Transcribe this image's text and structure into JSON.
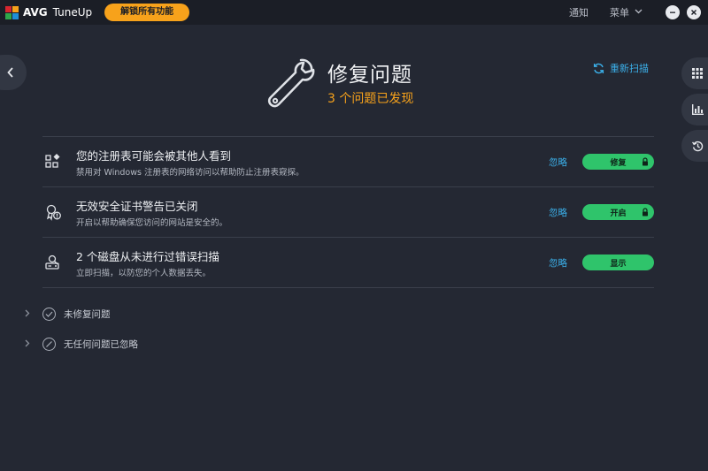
{
  "app": {
    "brand": "AVG",
    "product": "TuneUp",
    "unlock_label": "解锁所有功能",
    "brand_colors": [
      "#d7262f",
      "#f7a21b",
      "#2fa64a",
      "#1f8fd6"
    ]
  },
  "titlebar": {
    "notifications_label": "通知",
    "menu_label": "菜单",
    "menu_icon": "chevron-down-icon",
    "minimize_icon": "minimize-icon",
    "close_icon": "close-icon"
  },
  "header": {
    "icon": "wrench-icon",
    "title": "修复问题",
    "subtitle": "3 个问题已发现",
    "rescan_label": "重新扫描",
    "rescan_icon": "refresh-icon"
  },
  "sidebar": {
    "back_icon": "chevron-left-icon",
    "items": [
      {
        "icon": "grid-icon"
      },
      {
        "icon": "bar-chart-icon"
      },
      {
        "icon": "history-icon"
      }
    ]
  },
  "issues": [
    {
      "icon": "registry-icon",
      "title": "您的注册表可能会被其他人看到",
      "description": "禁用对 Windows 注册表的网络访问以帮助防止注册表窥探。",
      "ignore_label": "忽略",
      "action_label": "修复",
      "locked": true
    },
    {
      "icon": "certificate-warning-icon",
      "title": "无效安全证书警告已关闭",
      "description": "开启以帮助确保您访问的网站是安全的。",
      "ignore_label": "忽略",
      "action_label": "开启",
      "locked": true
    },
    {
      "icon": "disk-scan-icon",
      "title": "2 个磁盘从未进行过错误扫描",
      "description": "立即扫描，以防您的个人数据丢失。",
      "ignore_label": "忽略",
      "action_label": "显示",
      "locked": false
    }
  ],
  "sections": [
    {
      "label": "未修复问题",
      "icon": "check-circle-icon"
    },
    {
      "label": "无任何问题已忽略",
      "icon": "no-entry-icon"
    }
  ],
  "colors": {
    "background": "#242833",
    "accent_orange": "#f7a21b",
    "accent_green": "#2fc46b",
    "link_blue": "#3bb0ea"
  }
}
